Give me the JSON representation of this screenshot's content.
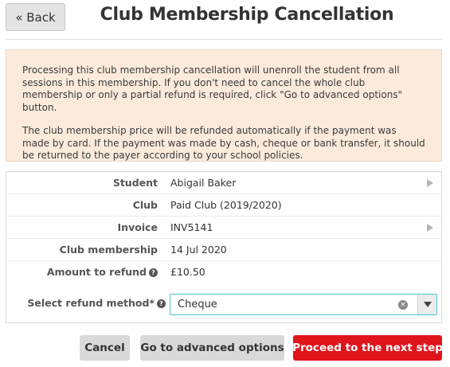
{
  "header": {
    "back_label": "« Back",
    "title": "Club Membership Cancellation"
  },
  "notice": {
    "paragraphs": [
      "Processing this club membership cancellation will unenroll the student from all sessions in this membership. If you don't need to cancel the whole club membership or only a partial refund is required, click \"Go to advanced options\" button.",
      "The club membership price will be refunded automatically if the payment was made by card. If the payment was made by cash, cheque or bank transfer, it should be returned to the payer according to your school policies."
    ]
  },
  "details": {
    "rows": [
      {
        "label": "Student",
        "value": "Abigail Baker"
      },
      {
        "label": "Club",
        "value": "Paid Club (2019/2020)"
      },
      {
        "label": "Invoice",
        "value": "INV5141"
      },
      {
        "label": "Club membership",
        "value": "14 Jul 2020"
      },
      {
        "label": "Amount to refund",
        "value": "£10.50"
      }
    ],
    "help_glyph": "?",
    "refund_method": {
      "label": "Select refund method*",
      "selected": "Cheque",
      "clear_glyph": "×"
    }
  },
  "actions": {
    "cancel_label": "Cancel",
    "advanced_label": "Go to advanced options",
    "proceed_label": "Proceed to the next step"
  },
  "colors": {
    "accent_red": "#e0151c",
    "notice_bg": "#fcebdc",
    "focus_border": "#4bc3c8"
  }
}
